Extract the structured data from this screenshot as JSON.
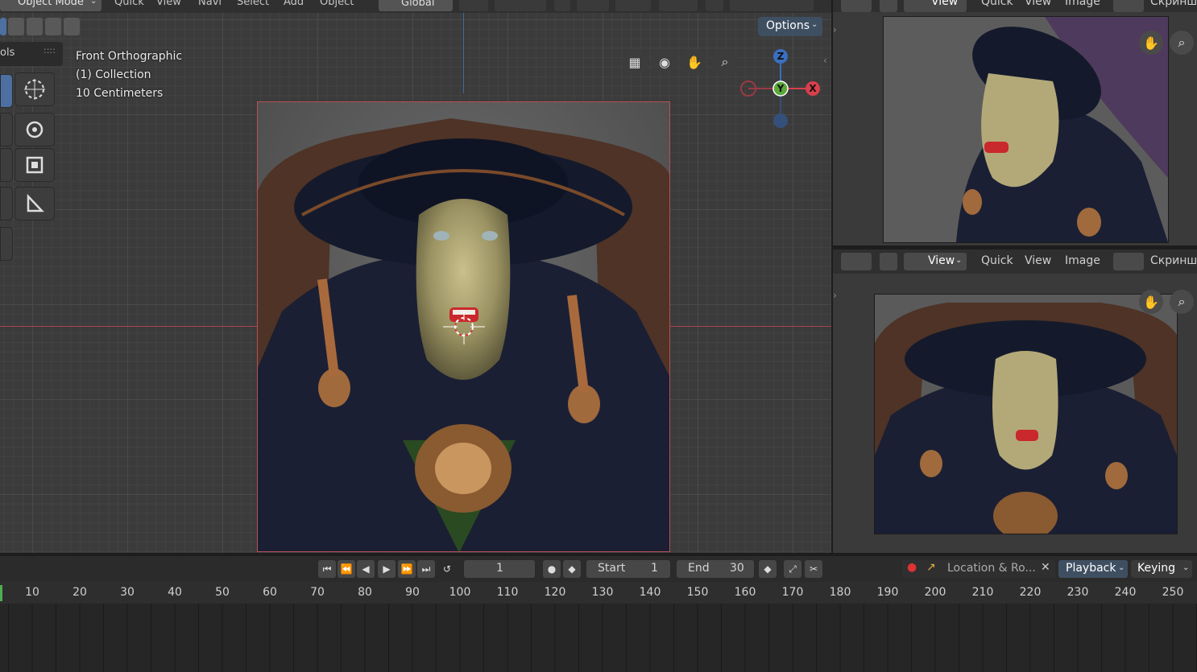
{
  "top_header": {
    "mode": "Object Mode",
    "menus": [
      "Quick",
      "View",
      "Navi",
      "Select",
      "Add",
      "Object"
    ],
    "orientation": "Global"
  },
  "viewport": {
    "view_name": "Front Orthographic",
    "collection": "(1) Collection",
    "scale": "10 Centimeters",
    "tools_tab": "ols",
    "options_label": "Options",
    "axes": {
      "z": "Z",
      "y": "Y",
      "x": "X"
    }
  },
  "image_editor_top": {
    "view_label": "View",
    "menus": [
      "Quick",
      "View",
      "Image"
    ],
    "image_name": "Скриншо"
  },
  "image_editor_bottom": {
    "view_label": "View",
    "menus": [
      "Quick",
      "View",
      "Image"
    ],
    "image_name": "Скриншо"
  },
  "timeline": {
    "current_frame": "1",
    "start_label": "Start",
    "start_value": "1",
    "end_label": "End",
    "end_value": "30",
    "keying_set": "Location & Ro...",
    "playback_label": "Playback",
    "keying_label": "Keying",
    "ruler": [
      "10",
      "20",
      "30",
      "40",
      "50",
      "60",
      "70",
      "80",
      "90",
      "100",
      "110",
      "120",
      "130",
      "140",
      "150",
      "160",
      "170",
      "180",
      "190",
      "200",
      "210",
      "220",
      "230",
      "240",
      "250"
    ]
  },
  "colors": {
    "accent_blue": "#4d6fa2",
    "x_axis": "#d8404c",
    "y_axis": "#5aa83a",
    "z_axis": "#3a6fc0"
  }
}
